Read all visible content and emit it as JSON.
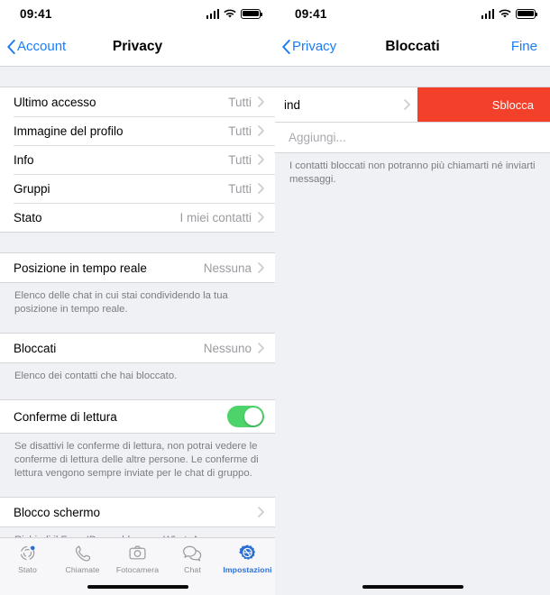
{
  "status_bar": {
    "time": "09:41",
    "signal_icon": "signal-bars-icon",
    "wifi_icon": "wifi-icon",
    "battery_icon": "battery-full-icon"
  },
  "left_screen": {
    "nav": {
      "back_label": "Account",
      "title": "Privacy"
    },
    "group1": [
      {
        "label": "Ultimo accesso",
        "value": "Tutti"
      },
      {
        "label": "Immagine del profilo",
        "value": "Tutti"
      },
      {
        "label": "Info",
        "value": "Tutti"
      },
      {
        "label": "Gruppi",
        "value": "Tutti"
      },
      {
        "label": "Stato",
        "value": "I miei contatti"
      }
    ],
    "live_location": {
      "label": "Posizione in tempo reale",
      "value": "Nessuna",
      "footnote": "Elenco delle chat in cui stai condividendo la tua posizione in tempo reale."
    },
    "blocked": {
      "label": "Bloccati",
      "value": "Nessuno",
      "footnote": "Elenco dei contatti che hai bloccato."
    },
    "read_receipts": {
      "label": "Conferme di lettura",
      "toggle_state": "on",
      "footnote": "Se disattivi le conferme di lettura, non potrai vedere le conferme di lettura delle altre persone. Le conferme di lettura vengono sempre inviate per le chat di gruppo."
    },
    "screen_lock": {
      "label": "Blocco schermo",
      "footnote": "Richiedi il Face ID per sbloccare WhatsApp."
    }
  },
  "right_screen": {
    "nav": {
      "back_label": "Privacy",
      "title": "Bloccati",
      "done_label": "Fine"
    },
    "swiped_row": {
      "label": "ind",
      "action_label": "Sblocca"
    },
    "add_row": {
      "placeholder": "Aggiungi..."
    },
    "footnote": "I contatti bloccati non potranno più chiamarti né inviarti messaggi."
  },
  "tab_bar": {
    "items": [
      {
        "label": "Stato",
        "icon": "status-rings-icon",
        "active": false
      },
      {
        "label": "Chiamate",
        "icon": "phone-icon",
        "active": false
      },
      {
        "label": "Fotocamera",
        "icon": "camera-icon",
        "active": false
      },
      {
        "label": "Chat",
        "icon": "chat-bubbles-icon",
        "active": false
      },
      {
        "label": "Impostazioni",
        "icon": "gear-icon",
        "active": true
      }
    ]
  },
  "colors": {
    "accent_blue": "#1a7cf7",
    "toggle_green": "#4cd369",
    "danger_red": "#f2402b",
    "tab_active": "#2a6fd4"
  }
}
